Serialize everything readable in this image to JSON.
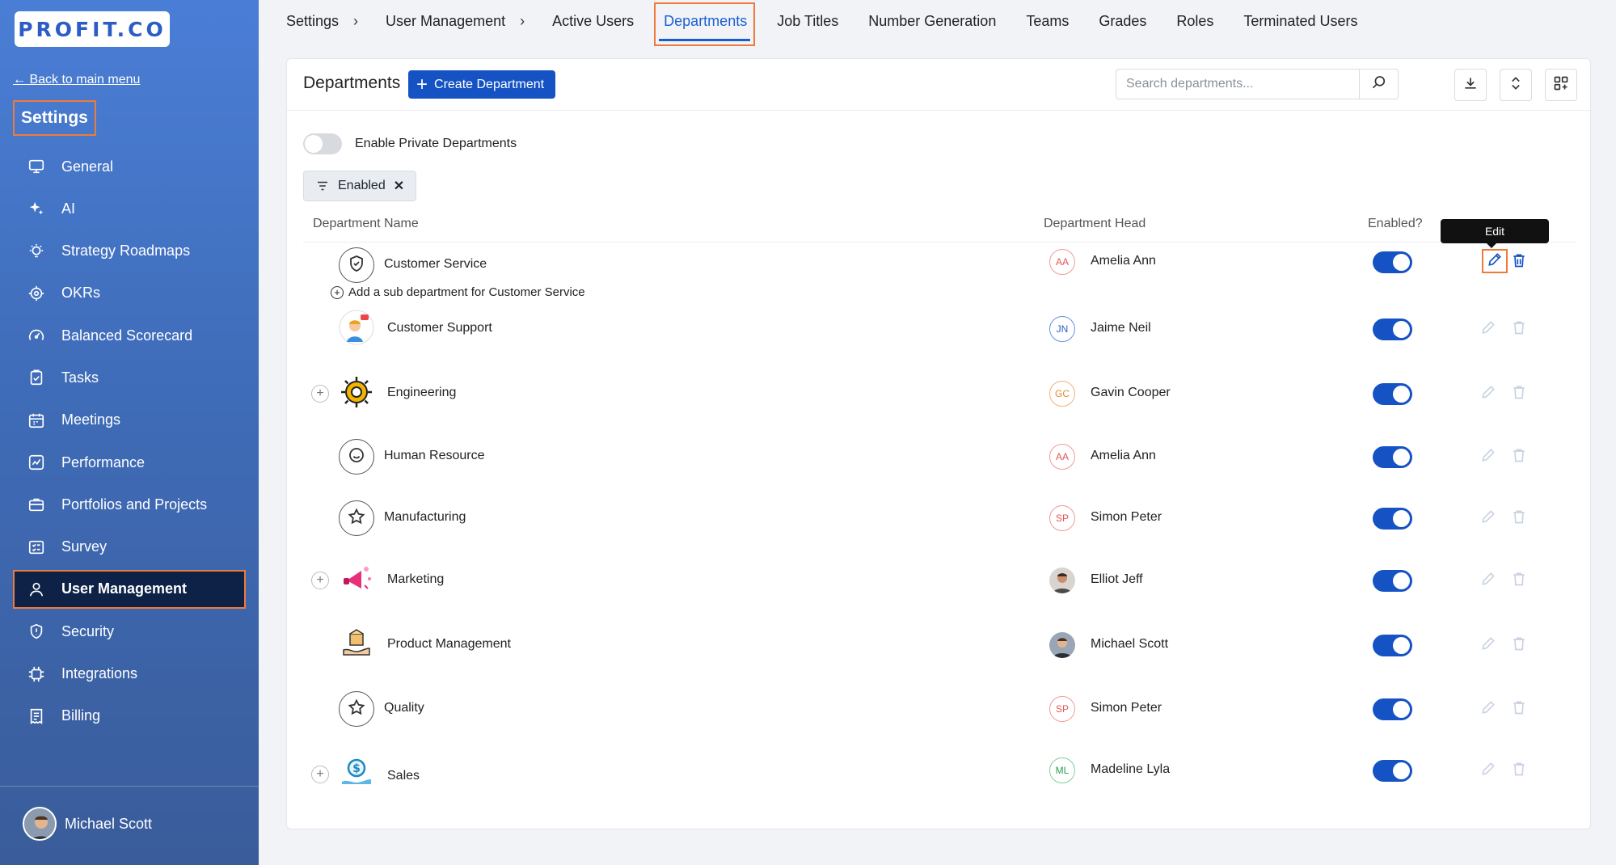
{
  "sidebar": {
    "logo": "PROFIT.CO",
    "back_link": "← Back to main menu",
    "section_title": "Settings",
    "items": [
      {
        "label": "General",
        "icon": "monitor-icon"
      },
      {
        "label": "AI",
        "icon": "sparkle-icon"
      },
      {
        "label": "Strategy Roadmaps",
        "icon": "bulb-icon"
      },
      {
        "label": "OKRs",
        "icon": "target-icon"
      },
      {
        "label": "Balanced Scorecard",
        "icon": "gauge-icon"
      },
      {
        "label": "Tasks",
        "icon": "clipboard-icon"
      },
      {
        "label": "Meetings",
        "icon": "calendar-icon"
      },
      {
        "label": "Performance",
        "icon": "chart-icon"
      },
      {
        "label": "Portfolios and Projects",
        "icon": "briefcase-icon"
      },
      {
        "label": "Survey",
        "icon": "survey-icon"
      },
      {
        "label": "User Management",
        "icon": "user-icon"
      },
      {
        "label": "Security",
        "icon": "shield-icon"
      },
      {
        "label": "Integrations",
        "icon": "chip-icon"
      },
      {
        "label": "Billing",
        "icon": "receipt-icon"
      }
    ],
    "active_index": 10,
    "user_name": "Michael Scott"
  },
  "breadcrumb": {
    "root": "Settings",
    "section": "User Management",
    "separator": "›"
  },
  "tabs": [
    {
      "label": "Active Users"
    },
    {
      "label": "Departments"
    },
    {
      "label": "Job Titles"
    },
    {
      "label": "Number Generation"
    },
    {
      "label": "Teams"
    },
    {
      "label": "Grades"
    },
    {
      "label": "Roles"
    },
    {
      "label": "Terminated Users"
    }
  ],
  "active_tab": "Departments",
  "header": {
    "title": "Departments",
    "create_label": "Create Department",
    "search_placeholder": "Search departments..."
  },
  "private_toggle": {
    "label": "Enable Private Departments",
    "enabled": false
  },
  "filter_chip": {
    "label": "Enabled"
  },
  "columns": {
    "name": "Department Name",
    "head": "Department Head",
    "enabled": "Enabled?"
  },
  "tooltip": "Edit",
  "sub_department_prompt": "Add a sub department for Customer Service",
  "rows": [
    {
      "name": "Customer Service",
      "head": "Amelia Ann",
      "initials": "AA",
      "enabled": true
    },
    {
      "name": "Customer Support",
      "head": "Jaime Neil",
      "initials": "JN",
      "enabled": true
    },
    {
      "name": "Engineering",
      "head": "Gavin Cooper",
      "initials": "GC",
      "enabled": true
    },
    {
      "name": "Human Resource",
      "head": "Amelia Ann",
      "initials": "AA",
      "enabled": true
    },
    {
      "name": "Manufacturing",
      "head": "Simon Peter",
      "initials": "SP",
      "enabled": true
    },
    {
      "name": "Marketing",
      "head": "Elliot Jeff",
      "initials": "",
      "enabled": true
    },
    {
      "name": "Product Management",
      "head": "Michael Scott",
      "initials": "",
      "enabled": true
    },
    {
      "name": "Quality",
      "head": "Simon Peter",
      "initials": "SP",
      "enabled": true
    },
    {
      "name": "Sales",
      "head": "Madeline Lyla",
      "initials": "ML",
      "enabled": true
    }
  ],
  "colors": {
    "accent": "#1553c4",
    "focus_outline": "#f07a3a",
    "sidebar_active": "#0e2248"
  }
}
